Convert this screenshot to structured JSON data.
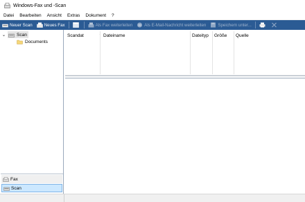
{
  "window": {
    "title": "Windows-Fax und -Scan",
    "icon": "fax-scanner-icon"
  },
  "menu": [
    "Datei",
    "Bearbeiten",
    "Ansicht",
    "Extras",
    "Dokument",
    "?"
  ],
  "toolbar": {
    "new_scan": "Neuer Scan",
    "new_fax": "Neues Fax",
    "forward_fax": "Als Fax weiterleiten",
    "forward_email": "Als E-Mail-Nachricht weiterleiten",
    "save_as": "Speichern unter...",
    "accent": "#2b5b94"
  },
  "tree": {
    "root": "Scan",
    "child": "Documents"
  },
  "nav": {
    "fax": "Fax",
    "scan": "Scan"
  },
  "list": {
    "columns": [
      "Scandat",
      "Dateiname",
      "Dateityp",
      "Größe",
      "Quelle"
    ],
    "sort_indicator": "↑"
  }
}
